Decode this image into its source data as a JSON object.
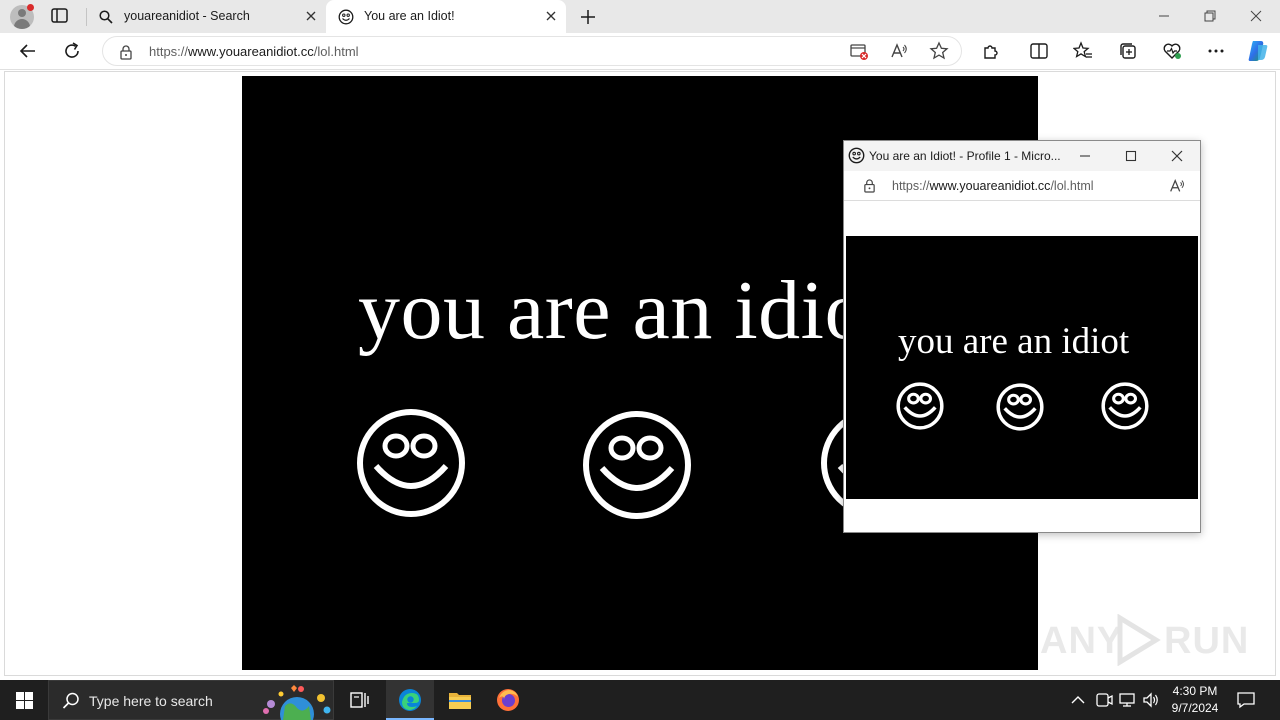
{
  "browser": {
    "tabs": [
      {
        "title": "youareanidiot - Search",
        "icon": "search-icon"
      },
      {
        "title": "You are an Idiot!",
        "icon": "smiley-icon",
        "active": true
      }
    ],
    "address": {
      "prefix": "https://",
      "host": "www.youareanidiot.cc",
      "path": "/lol.html"
    }
  },
  "page": {
    "headline": "you are an idiot",
    "smileys": 3
  },
  "popup": {
    "title": "You are an Idiot! - Profile 1 - Micro...",
    "address": {
      "prefix": "https://",
      "host": "www.youareanidiot.cc",
      "path": "/lol.html"
    },
    "headline": "you are an idiot",
    "smileys": 3
  },
  "watermark": {
    "left": "ANY",
    "right": "RUN"
  },
  "taskbar": {
    "search_placeholder": "Type here to search",
    "time": "4:30 PM",
    "date": "9/7/2024"
  },
  "colors": {
    "stage": "#000000",
    "foreground": "#ffffff",
    "taskbar": "#1f1f1f",
    "edge_accent": "#0a84d8",
    "firefox": "#ff7139"
  }
}
